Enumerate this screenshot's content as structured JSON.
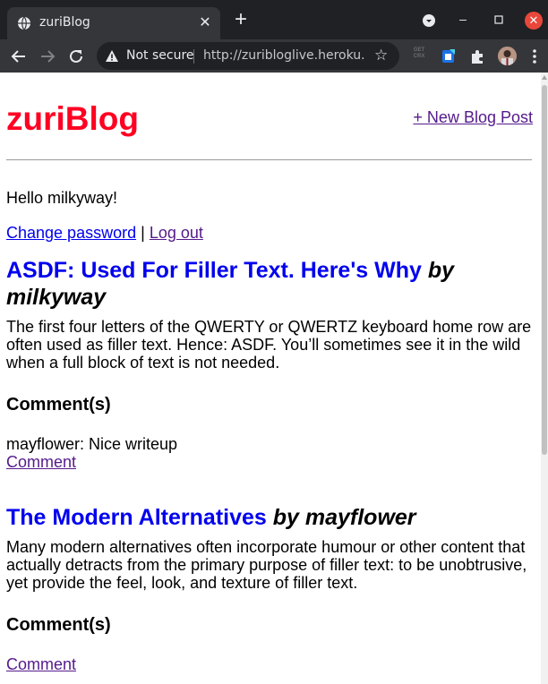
{
  "browser": {
    "tab_title": "zuriBlog",
    "tab_close": "✕",
    "new_tab": "+",
    "security_label": "Not secure",
    "url": "http://zuribloglive.heroku...",
    "getcrx_top": "GET",
    "getcrx_bottom": "CRX",
    "minimize": "–",
    "close": "✕"
  },
  "site": {
    "title": "zuriBlog",
    "new_post_link": "+ New Blog Post"
  },
  "account": {
    "greeting": "Hello milkyway!",
    "change_password": "Change password",
    "separator": "|",
    "logout": "Log out"
  },
  "posts": [
    {
      "title": "ASDF: Used For Filler Text. Here's Why",
      "byline": "by milkyway",
      "body": "The first four letters of the QWERTY or QWERTZ keyboard home row are often used as filler text. Hence: ASDF. You’ll sometimes see it in the wild when a full block of text is not needed.",
      "comments_heading": "Comment(s)",
      "comment": "mayflower: Nice writeup",
      "comment_link": "Comment"
    },
    {
      "title": "The Modern Alternatives",
      "byline": "by mayflower",
      "body": "Many modern alternatives often incorporate humour or other content that actually detracts from the primary purpose of filler text: to be unobtrusive, yet provide the feel, look, and texture of filler text.",
      "comments_heading": "Comment(s)",
      "comment_link": "Comment"
    }
  ],
  "colors": {
    "site_title": "#ff0022",
    "link_unvisited": "#0000ee",
    "link_visited": "#551a8b",
    "chrome_dark": "#202124",
    "chrome_tab": "#35363a"
  }
}
